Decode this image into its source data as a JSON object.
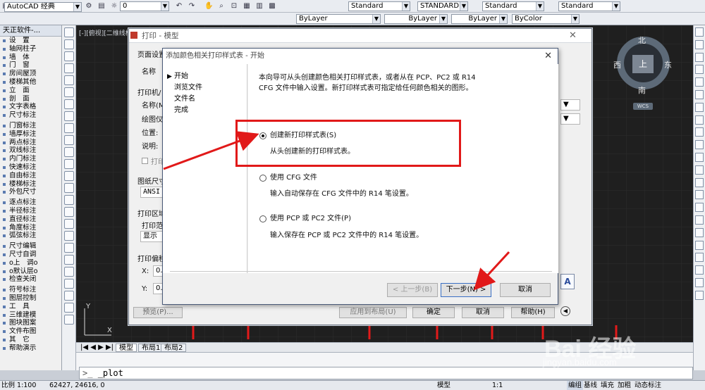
{
  "toolbar1": {
    "workspace": "AutoCAD 经典",
    "layer": "0",
    "textstyle": "Standard",
    "dimstyle": "STANDARD",
    "tablestyle": "Standard",
    "mleaderstyle": "Standard"
  },
  "toolbar2": {
    "layer_color": "ByLayer",
    "linetype": "ByLayer",
    "lineweight": "ByLayer",
    "plotstyle": "ByColor"
  },
  "left_panel": {
    "title": "天正软件-...",
    "groups": [
      [
        "设　置",
        "轴网柱子",
        "墙　体",
        "门　窗",
        "房间屋顶",
        "楼梯其他",
        "立　面",
        "剖　面",
        "文字表格",
        "尺寸标注"
      ],
      [
        "门窗标注",
        "墙厚标注",
        "两点标注",
        "双线标注",
        "内门标注",
        "快速标注",
        "自由标注",
        "楼梯标注",
        "外包尺寸"
      ],
      [
        "逐点标注",
        "半径标注",
        "直径标注",
        "角度标注",
        "弧弦标注"
      ],
      [
        "尺寸编辑",
        "尺寸自调",
        "o上　调o",
        "o默认层o",
        "检查关闭"
      ],
      [
        "符号标注",
        "图层控制",
        "工　具",
        "三维建模",
        "图块图案",
        "文件布图",
        "其　它",
        "帮助演示"
      ]
    ]
  },
  "canvas": {
    "view_label": "[-][俯视][二维线框]",
    "compass": {
      "north": "北",
      "south": "南",
      "east": "东",
      "west": "西",
      "top": "上",
      "wcs": "WCS"
    },
    "tabs": [
      "模型",
      "布局1",
      "布局2"
    ]
  },
  "command_line": "_plot",
  "status_bar": {
    "scale": "比例 1:100",
    "coords": "62427, 24616, 0",
    "space": "模型",
    "annotation_scale": "1:1",
    "buttons": [
      "编组",
      "基线",
      "填充",
      "加粗",
      "动态标注"
    ]
  },
  "print_dialog": {
    "title": "打印 - 模型",
    "labels": {
      "page_setup": "页面设置",
      "name": "名称",
      "printer": "打印机/",
      "printer_name": "名称(M",
      "plotter": "绘图仪",
      "location": "位置:",
      "description": "说明:",
      "print_to_file": "打印",
      "paper_size": "图纸尺寸",
      "paper_value": "ANSI",
      "plot_area": "打印区域",
      "plot_range": "打印范",
      "display": "显示",
      "plot_offset": "打印偏移",
      "x": "X:",
      "y": "Y:",
      "x_val": "0.",
      "y_val": "0."
    },
    "buttons": {
      "preview": "预览(P)...",
      "apply": "应用到布局(U)",
      "ok": "确定",
      "cancel": "取消",
      "help": "帮助(H)"
    }
  },
  "wizard": {
    "title": "添加颜色相关打印样式表 - 开始",
    "steps": [
      "开始",
      "浏览文件",
      "文件名",
      "完成"
    ],
    "intro": [
      "本向导可从头创建颜色相关打印样式表，或者从在 PCP、PC2 或 R14",
      "CFG 文件中输入设置。新打印样式表可指定给任何颜色相关的图形。"
    ],
    "options": [
      {
        "label": "创建新打印样式表(S)",
        "desc": "从头创建新的打印样式表。",
        "selected": true
      },
      {
        "label": "使用 CFG 文件",
        "desc": "输入自动保存在 CFG 文件中的 R14 笔设置。",
        "selected": false
      },
      {
        "label": "使用 PCP 或 PC2 文件(P)",
        "desc": "输入保存在 PCP 或 PC2 文件中的 R14 笔设置。",
        "selected": false
      }
    ],
    "buttons": {
      "back": "< 上一步(B)",
      "next": "下一步(N) >",
      "cancel": "取消"
    }
  },
  "watermark": {
    "brand": "Bai 经验",
    "url": "jingyan.baidu.com"
  },
  "colors": {
    "highlight": "#e11919",
    "canvas": "#1f1f1f",
    "accent": "#3a5ea8"
  }
}
